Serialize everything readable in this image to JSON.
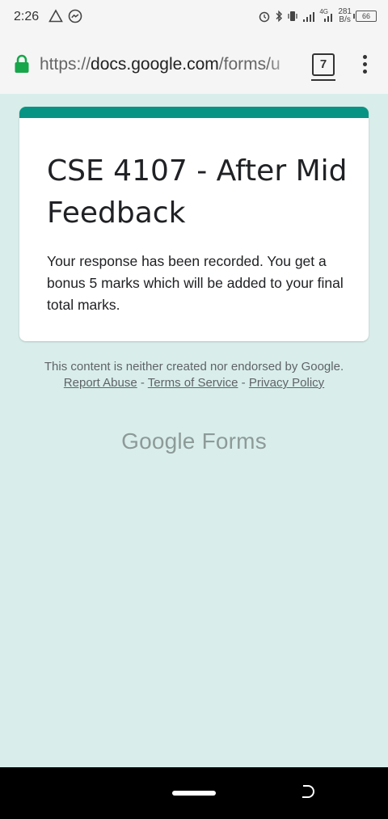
{
  "status_bar": {
    "time": "2:26",
    "speed_value": "281",
    "speed_unit": "B/s",
    "battery": "66",
    "net_label": "4G"
  },
  "url_bar": {
    "scheme": "https://",
    "domain": "docs.google.com",
    "path": "/forms/u",
    "tab_count": "7"
  },
  "form": {
    "title": "CSE 4107 - After Mid Feedback",
    "response_message": "Your response has been recorded. You get a bonus 5 marks which will be added to your final total marks.",
    "accent_color": "#089484"
  },
  "footer": {
    "disclaimer": "This content is neither created nor endorsed by Google.",
    "report_abuse": "Report Abuse",
    "separator": "-",
    "terms": "Terms of Service",
    "privacy": "Privacy Policy"
  },
  "branding": {
    "google": "Google",
    "forms": "Forms"
  }
}
